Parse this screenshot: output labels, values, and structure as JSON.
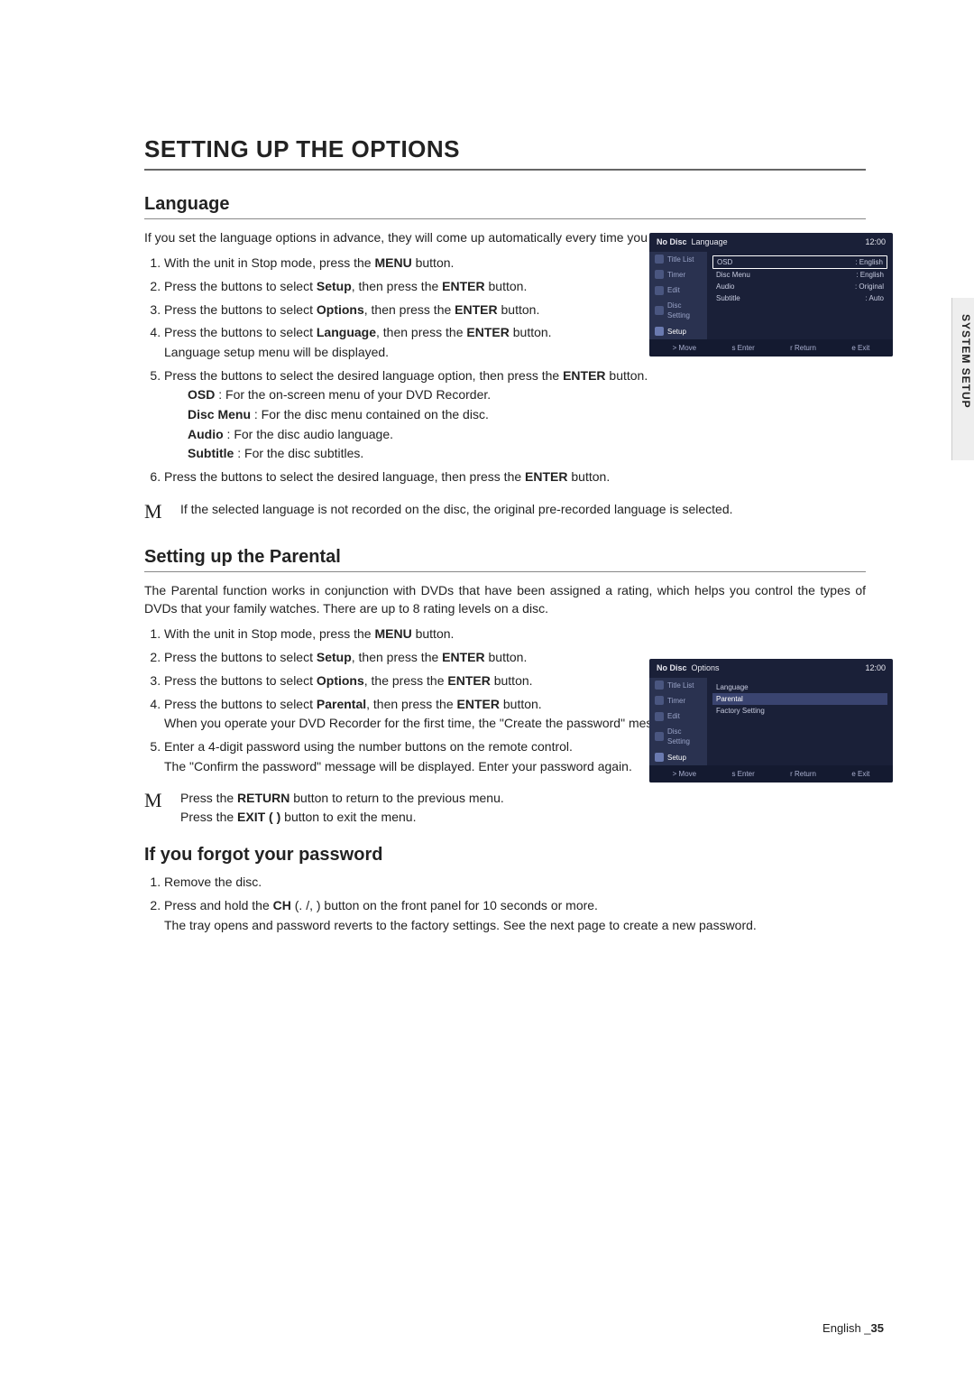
{
  "page_title": "SETTING UP THE OPTIONS",
  "side_tab_label": "SYSTEM SETUP",
  "footer": {
    "lang": "English",
    "page_num": "35"
  },
  "language": {
    "heading": "Language",
    "intro": "If you set the language options in advance, they will come up automatically every time you watch a movie.",
    "steps": [
      {
        "pre": "With the unit in Stop mode, press the ",
        "bold": "MENU",
        "post": " button."
      },
      {
        "pre": "Press the        buttons to select ",
        "bold": "Setup",
        "post": ", then press the ",
        "bold2": "ENTER",
        "post2": " button."
      },
      {
        "pre": "Press the        buttons to select ",
        "bold": "Options",
        "post": ", then press the ",
        "bold2": "ENTER",
        "post2": " button."
      },
      {
        "pre": "Press the        buttons to select ",
        "bold": "Language",
        "post": ", then press the ",
        "bold2": "ENTER",
        "post2": " button.",
        "after": "Language setup menu will be displayed."
      },
      {
        "pre": "Press the        buttons to select the desired language option, then press the ",
        "bold": "ENTER",
        "post": " button."
      },
      {
        "pre": "Press the        buttons to select the desired language, then press the ",
        "bold": "ENTER",
        "post": " button."
      }
    ],
    "options_list": [
      {
        "label": "OSD",
        "text": " : For the on-screen menu of your DVD Recorder."
      },
      {
        "label": "Disc Menu",
        "text": " : For the disc menu contained on the disc."
      },
      {
        "label": "Audio",
        "text": " : For the disc audio language."
      },
      {
        "label": "Subtitle",
        "text": " : For the disc subtitles."
      }
    ],
    "note": "If the selected language is not recorded on the disc, the original pre-recorded language is selected."
  },
  "parental": {
    "heading": "Setting up the Parental",
    "intro": "The Parental function works in conjunction with DVDs that have been assigned a rating, which helps you control the types of DVDs that your family watches. There are up to 8 rating levels on a disc.",
    "steps": [
      {
        "pre": "With the unit in Stop mode, press the ",
        "bold": "MENU",
        "post": " button."
      },
      {
        "pre": "Press the        buttons to select ",
        "bold": "Setup",
        "post": ", then press the ",
        "bold2": "ENTER",
        "post2": " button."
      },
      {
        "pre": "Press the        buttons to select ",
        "bold": "Options",
        "post": ", the press the ",
        "bold2": "ENTER",
        "post2": " button."
      },
      {
        "pre": "Press the        buttons to select ",
        "bold": "Parental",
        "post": ", then press the ",
        "bold2": "ENTER",
        "post2": " button.",
        "after": "When you operate your DVD Recorder for the first time, the \"Create the password\" message will be displayed."
      },
      {
        "full": "Enter a 4-digit password using the number buttons on the remote control.\nThe \"Confirm the password\" message will be displayed. Enter your password again."
      }
    ],
    "note1_pre": "Press the ",
    "note1_bold1": "RETURN",
    "note1_mid": " button to return to the previous menu.",
    "note2_pre": "Press the ",
    "note2_bold1": "EXIT (   )",
    "note2_mid": " button to exit the menu."
  },
  "forgot": {
    "heading": "If you forgot your password",
    "steps": [
      {
        "full": "Remove the disc."
      },
      {
        "pre": "Press and hold the ",
        "bold": "CH",
        "mid": " (.   /,   ) button on the front panel for 10 seconds or more.\nThe tray opens and password reverts to the factory settings. See the next page to create a new password."
      }
    ]
  },
  "osd_lang": {
    "status_left": "No Disc",
    "title": "Language",
    "time": "12:00",
    "side": [
      "Title List",
      "Timer",
      "Edit",
      "Disc Setting",
      "Setup"
    ],
    "rows": [
      {
        "k": "OSD",
        "v": ": English",
        "hl": true
      },
      {
        "k": "Disc Menu",
        "v": ": English"
      },
      {
        "k": "Audio",
        "v": ": Original"
      },
      {
        "k": "Subtitle",
        "v": ": Auto"
      }
    ],
    "foot": [
      "> Move",
      "s  Enter",
      "r  Return",
      "e  Exit"
    ]
  },
  "osd_opt": {
    "status_left": "No Disc",
    "title": "Options",
    "time": "12:00",
    "side": [
      "Title List",
      "Timer",
      "Edit",
      "Disc Setting",
      "Setup"
    ],
    "rows": [
      {
        "k": "Language",
        "v": ""
      },
      {
        "k": "Parental",
        "v": "",
        "sel": true
      },
      {
        "k": "Factory Setting",
        "v": ""
      }
    ],
    "foot": [
      "> Move",
      "s  Enter",
      "r  Return",
      "e  Exit"
    ]
  }
}
